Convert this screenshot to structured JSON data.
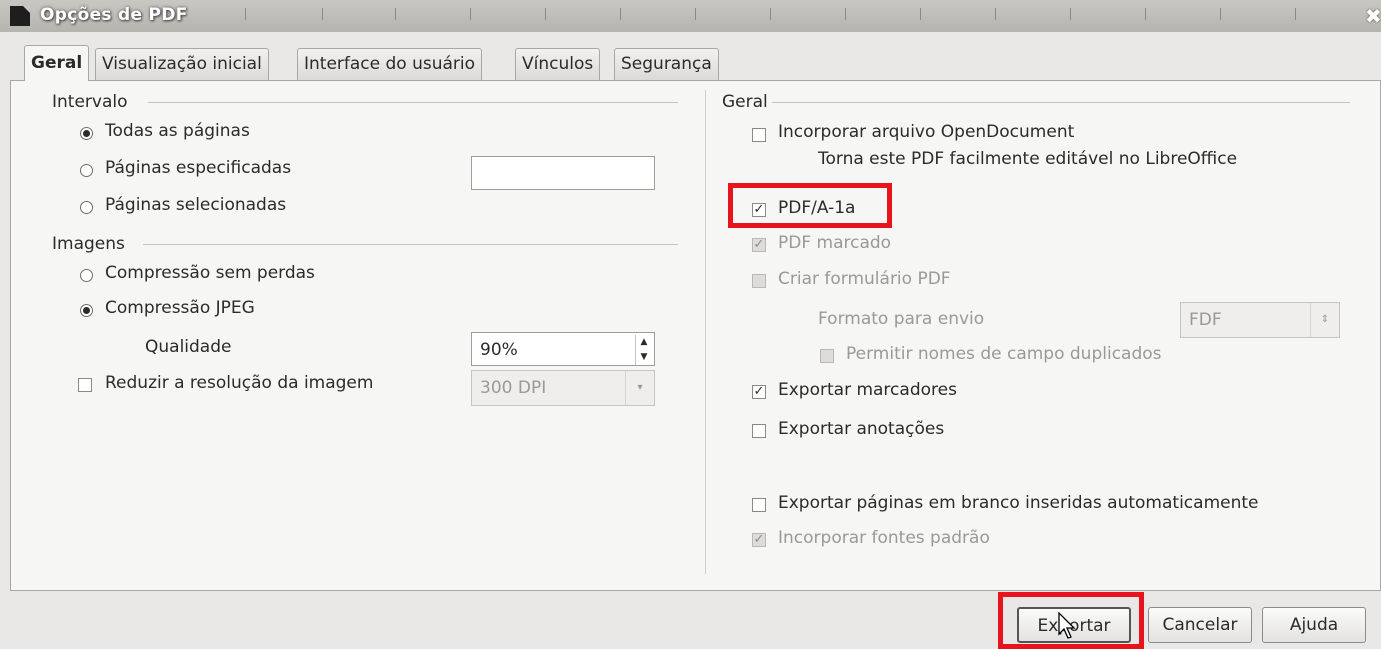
{
  "window": {
    "title": "Opções de PDF"
  },
  "tabs": [
    "Geral",
    "Visualização inicial",
    "Interface do usuário",
    "Vínculos",
    "Segurança"
  ],
  "left": {
    "range": {
      "heading": "Intervalo",
      "all_pages": "Todas as páginas",
      "specified_pages": "Páginas especificadas",
      "specified_pages_value": "",
      "selected_pages": "Páginas selecionadas"
    },
    "images": {
      "heading": "Imagens",
      "lossless": "Compressão sem perdas",
      "jpeg": "Compressão JPEG",
      "quality_label": "Qualidade",
      "quality_value": "90%",
      "reduce_resolution": "Reduzir a resolução da imagem",
      "resolution_value": "300 DPI"
    }
  },
  "right": {
    "heading": "Geral",
    "embed_odf": "Incorporar arquivo OpenDocument",
    "embed_odf_hint": "Torna este PDF facilmente editável no LibreOffice",
    "pdfa": "PDF/A-1a",
    "tagged_pdf": "PDF marcado",
    "create_form": "Criar formulário PDF",
    "submit_format_label": "Formato para envio",
    "submit_format_value": "FDF",
    "allow_duplicate": "Permitir nomes de campo duplicados",
    "export_bookmarks": "Exportar marcadores",
    "export_comments": "Exportar anotações",
    "export_blank_pages": "Exportar páginas em branco inseridas automaticamente",
    "embed_std_fonts": "Incorporar fontes padrão"
  },
  "buttons": {
    "export": "Exportar",
    "cancel": "Cancelar",
    "help": "Ajuda"
  },
  "state": {
    "all_pages_selected": true,
    "jpeg_selected": true,
    "pdfa_checked": true,
    "tagged_pdf_checked": true,
    "export_bookmarks_checked": true,
    "embed_std_fonts_checked": true
  },
  "colors": {
    "highlight": "#e8141d",
    "dialog_bg": "#f6f6f5",
    "disabled_text": "#9a9996"
  },
  "icons": [
    "document-icon",
    "close-icon",
    "radio-icon",
    "checkbox-icon",
    "spin-arrows-icon",
    "dropdown-arrow-icon",
    "mouse-cursor-icon"
  ]
}
